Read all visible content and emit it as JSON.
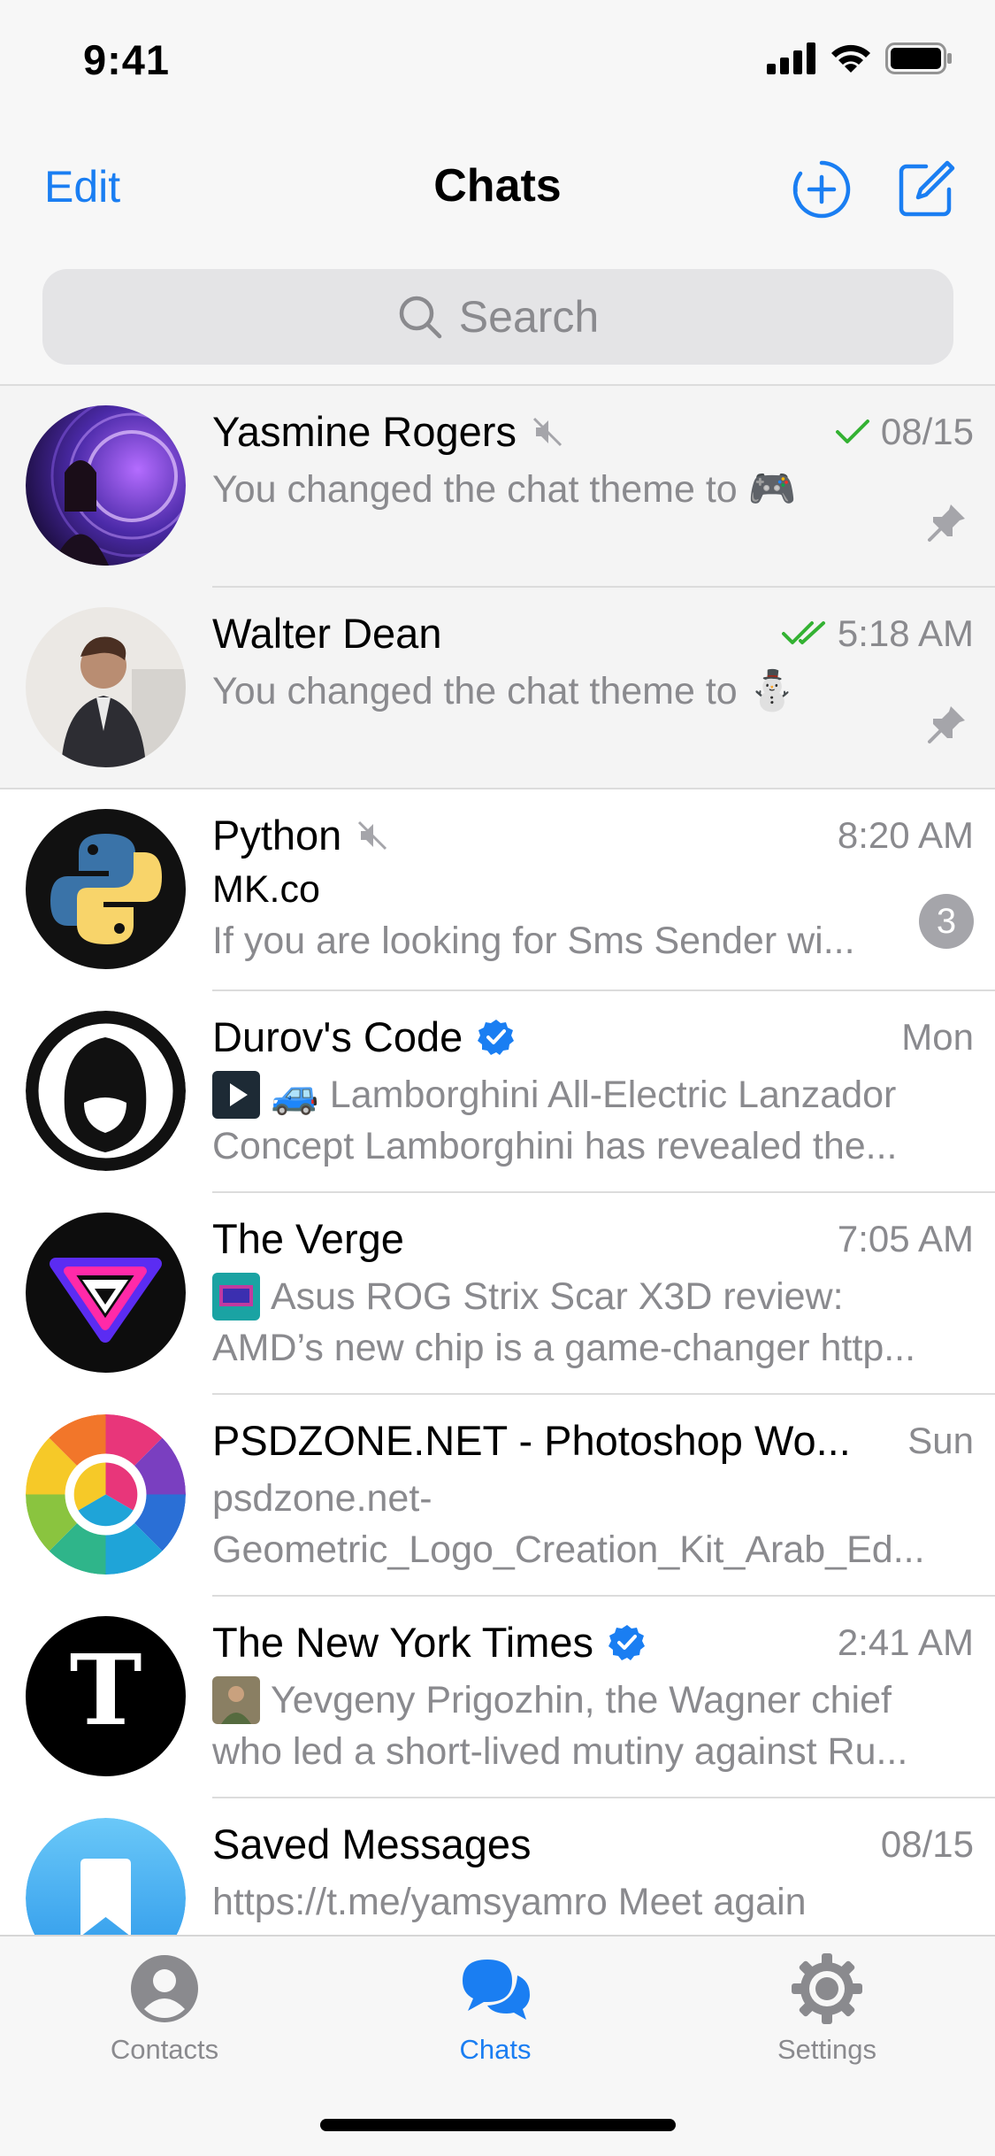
{
  "status_bar": {
    "time": "9:41"
  },
  "nav": {
    "edit_label": "Edit",
    "title": "Chats",
    "icons": [
      "new-story-icon",
      "compose-icon"
    ]
  },
  "search": {
    "placeholder": "Search"
  },
  "accent_color": "#1a7ef2",
  "chats": [
    {
      "name": "Yasmine Rogers",
      "muted": true,
      "time": "08/15",
      "status": "read-single",
      "line1": "You changed the chat theme to",
      "emoji": "🎮",
      "pinned": true
    },
    {
      "name": "Walter Dean",
      "muted": false,
      "time": "5:18 AM",
      "status": "read-double",
      "line1": "You changed the chat theme to",
      "emoji": "⛄",
      "pinned": true
    },
    {
      "name": "Python",
      "muted": true,
      "time": "8:20 AM",
      "sender": "MK.co",
      "line1": "If you are looking for Sms Sender wi...",
      "unread": "3"
    },
    {
      "name": "Durov's Code",
      "verified": true,
      "time": "Mon",
      "line1": "Lamborghini All-Electric Lanzador",
      "line2": "Concept Lamborghini has revealed the...",
      "emoji": "🚙"
    },
    {
      "name": "The Verge",
      "time": "7:05 AM",
      "line1": "Asus ROG Strix Scar X3D review:",
      "line2": "AMD’s new chip is a game-changer http..."
    },
    {
      "name": "PSDZONE.NET - Photoshop Wo...",
      "time": "Sun",
      "line1": "psdzone.net-",
      "line2": "Geometric_Logo_Creation_Kit_Arab_Ed..."
    },
    {
      "name": "The New York Times",
      "verified": true,
      "time": "2:41 AM",
      "line1": "Yevgeny Prigozhin, the Wagner chief",
      "line2": "who led a short-lived mutiny against Ru..."
    },
    {
      "name": "Saved Messages",
      "time": "08/15",
      "line1": "https://t.me/yamsyamro Meet again"
    }
  ],
  "tabs": [
    {
      "label": "Contacts",
      "icon": "person-icon",
      "active": false
    },
    {
      "label": "Chats",
      "icon": "chat-bubbles-icon",
      "active": true
    },
    {
      "label": "Settings",
      "icon": "gear-icon",
      "active": false
    }
  ]
}
